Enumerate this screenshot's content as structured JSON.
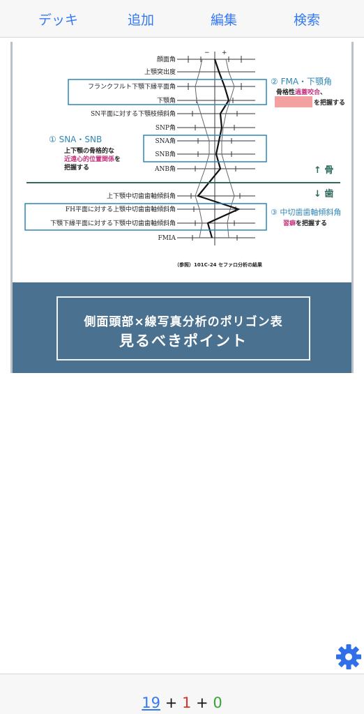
{
  "topbar": {
    "tabs": [
      "デッキ",
      "追加",
      "編集",
      "検索"
    ]
  },
  "card": {
    "figure": {
      "row_labels": [
        "顔面角",
        "上顎突出度",
        "フランクフルト下顎下縁平面角",
        "下顎角",
        "SN平面に対する下顎枝傾斜角",
        "SNP角",
        "SNA角",
        "SNB角",
        "ANB角",
        "上下顎中切歯歯軸傾斜角",
        "FH平面に対する上顎中切歯歯軸傾斜角",
        "下顎下縁平面に対する下顎中切歯歯軸傾斜角",
        "FMIA"
      ],
      "callout1_title": "① SNA・SNB",
      "callout1_line1": "上下顎の骨格的な",
      "callout1_highlight": "近遠心的位置関係",
      "callout1_suffix": "を",
      "callout1_line3": "把握する",
      "callout2_title": "② FMA・下顎角",
      "callout2_prefix": "骨格性",
      "callout2_highlight": "過蓋咬合",
      "callout2_suffix": "、",
      "callout2_line2": "を把握する",
      "callout3_title": "③ 中切歯歯軸傾斜角",
      "callout3_highlight": "習癖",
      "callout3_suffix": "を把握する",
      "bone_label": "↑ 骨",
      "tooth_label": "↓ 歯",
      "reference": "（参照）101C-24 セファロ分析の結果",
      "accent_color": "#2f86b6",
      "highlight_color": "#c4357e",
      "cloze_color": "#f2a0a0"
    },
    "banner": {
      "line1": "側面頭部×線写真分析のポリゴン表",
      "line2": "見るべきポイント",
      "background": "#4a7190"
    }
  },
  "settings": {
    "icon": "gear-icon"
  },
  "footer": {
    "new_count": "19",
    "plus1": "+",
    "learn_count": "1",
    "plus2": "+",
    "review_count": "0"
  }
}
